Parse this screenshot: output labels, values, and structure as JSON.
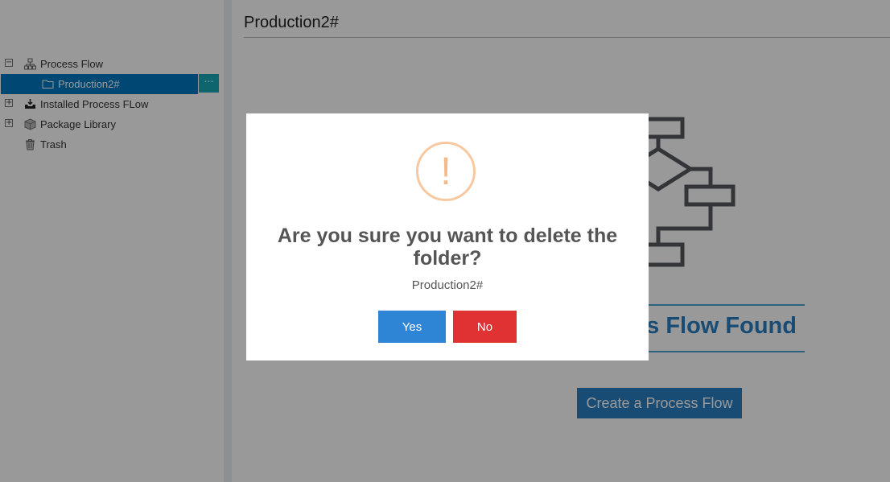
{
  "sidebar": {
    "items": [
      {
        "label": "Process Flow",
        "toggle": "−",
        "icon": "sitemap-icon"
      },
      {
        "label": "Production2#",
        "icon": "folder-icon",
        "more": "⋯"
      },
      {
        "label": "Installed Process FLow",
        "toggle": "+",
        "icon": "inbox-download-icon"
      },
      {
        "label": "Package Library",
        "toggle": "+",
        "icon": "package-icon"
      },
      {
        "label": "Trash",
        "icon": "trash-icon"
      }
    ]
  },
  "main": {
    "title": "Production2#",
    "empty_text": "No Process Flow Found",
    "create_button": "Create a Process Flow"
  },
  "modal": {
    "icon": "!",
    "title": "Are you sure you want to delete the folder?",
    "subtitle": "Production2#",
    "yes_label": "Yes",
    "no_label": "No",
    "colors": {
      "yes": "#2f85d5",
      "no": "#e03232",
      "warning": "#f8c9a0"
    }
  }
}
